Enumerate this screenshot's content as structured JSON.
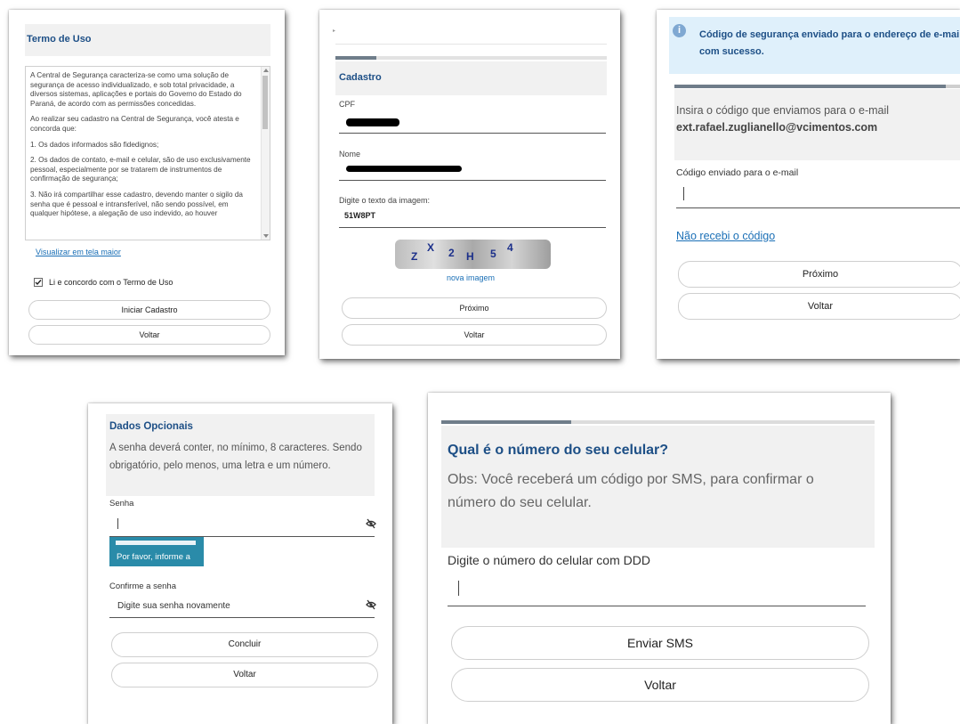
{
  "p1": {
    "title": "Termo de Uso",
    "paragraphs": [
      "A Central de Segurança caracteriza-se como uma solução de segurança de acesso individualizado, e sob total privacidade, a diversos sistemas, aplicações e portais do Governo do Estado do Paraná, de acordo com as permissões concedidas.",
      "Ao realizar seu cadastro na Central de Segurança, você atesta e concorda que:",
      "1. Os dados informados são fidedignos;",
      "2. Os dados de contato, e-mail e celular, são de uso exclusivamente pessoal, especialmente por se tratarem de instrumentos de confirmação de segurança;",
      "3. Não irá compartilhar esse cadastro, devendo manter o sigilo da senha que é pessoal e intransferível, não sendo possível, em qualquer hipótese, a alegação de uso indevido, ao houver"
    ],
    "view_larger_link": "Visualizar em tela maior",
    "agree_label": "Li e concordo com o Termo de Uso",
    "agree_checked": true,
    "start_button": "Iniciar Cadastro",
    "back_button": "Voltar"
  },
  "p2": {
    "top_mark": "▸",
    "section_title": "Cadastro",
    "cpf_label": "CPF",
    "name_label": "Nome",
    "captcha_label": "Digite o texto da imagem:",
    "captcha_value": "51W8PT",
    "captcha_chars": [
      "Z",
      "X",
      "2",
      "H",
      "5",
      "4"
    ],
    "new_image_link": "nova imagem",
    "next_button": "Próximo",
    "back_button": "Voltar",
    "progress": 0.15
  },
  "p3": {
    "info_text": "Código de segurança enviado para o endereço de e-mail com sucesso.",
    "instruction": "Insira o código que enviamos para o e-mail",
    "email": "ext.rafael.zuglianello@vcimentos.com",
    "code_label": "Código enviado para o e-mail",
    "not_received_link": "Não recebi o código",
    "next_button": "Próximo",
    "back_button": "Voltar",
    "progress": 0.95
  },
  "p4": {
    "title": "Dados Opcionais",
    "rule_text": "A senha deverá conter, no mínimo, 8 caracteres. Sendo obrigatório, pelo menos, uma letra e um número.",
    "password_label": "Senha",
    "tooltip_text": "Por favor, informe a",
    "confirm_label": "Confirme a senha",
    "confirm_placeholder": "Digite sua senha novamente",
    "finish_button": "Concluir",
    "back_button": "Voltar"
  },
  "p5": {
    "question": "Qual é o número do seu celular?",
    "note": "Obs: Você receberá um código por SMS, para confirmar o número do seu celular.",
    "phone_label": "Digite o número do celular com DDD",
    "send_button": "Enviar SMS",
    "back_button": "Voltar",
    "progress": 0.3
  },
  "colors": {
    "link_blue": "#1a6fb6",
    "title_blue": "#1d4f86",
    "tooltip_teal": "#2a8ba9",
    "info_bg": "#dff0fb",
    "progress_fill": "#6f7d8a"
  }
}
